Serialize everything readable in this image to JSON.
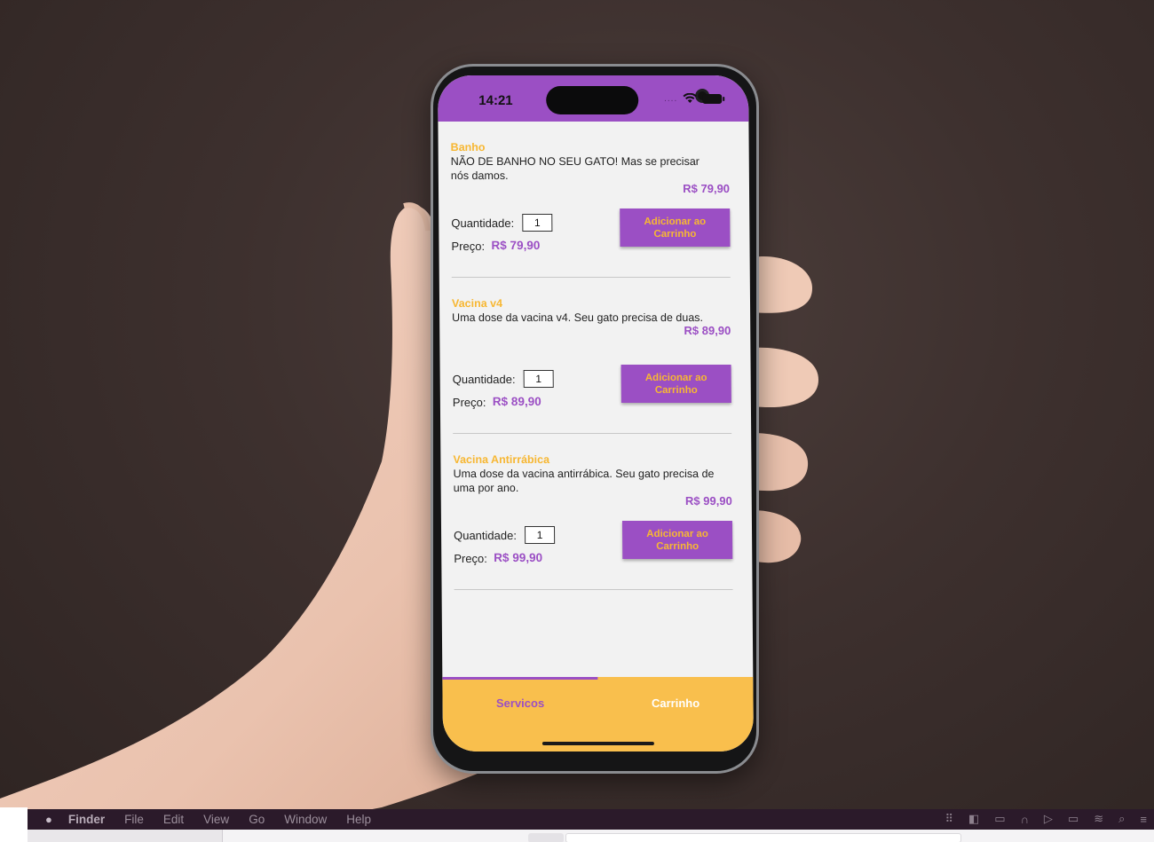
{
  "status_bar": {
    "time": "14:21",
    "signal": "....",
    "wifi_icon": "wifi-icon",
    "battery_icon": "battery-icon"
  },
  "colors": {
    "primary_purple": "#9b4fc4",
    "accent_yellow": "#f9bf4d",
    "title_yellow": "#f7b733"
  },
  "services": [
    {
      "title": "Banho",
      "description": "NÃO DE BANHO NO SEU GATO! Mas se precisar nós damos.",
      "price": "R$ 79,90",
      "quantity_label": "Quantidade:",
      "quantity_value": "1",
      "preco_label": "Preço:",
      "preco_value": "R$ 79,90",
      "button_label": "Adicionar ao Carrinho"
    },
    {
      "title": "Vacina v4",
      "description": "Uma dose da vacina v4. Seu gato precisa de duas.",
      "price": "R$ 89,90",
      "quantity_label": "Quantidade:",
      "quantity_value": "1",
      "preco_label": "Preço:",
      "preco_value": "R$ 89,90",
      "button_label": "Adicionar ao Carrinho"
    },
    {
      "title": "Vacina Antirrábica",
      "description": "Uma dose da vacina antirrábica. Seu gato precisa de uma por ano.",
      "price": "R$ 99,90",
      "quantity_label": "Quantidade:",
      "quantity_value": "1",
      "preco_label": "Preço:",
      "preco_value": "R$ 99,90",
      "button_label": "Adicionar ao Carrinho"
    }
  ],
  "tabs": [
    {
      "label": "Servicos",
      "active": true
    },
    {
      "label": "Carrinho",
      "active": false
    }
  ],
  "mac_menubar": {
    "apple_icon": "apple-icon",
    "app_name": "Finder",
    "items": [
      "File",
      "Edit",
      "View",
      "Go",
      "Window",
      "Help"
    ],
    "status_icons": [
      "keyboard-icon",
      "sidebar-icon",
      "window-icon",
      "headphones-icon",
      "play-icon",
      "battery-icon",
      "wifi-icon",
      "search-icon",
      "control-center-icon"
    ]
  }
}
